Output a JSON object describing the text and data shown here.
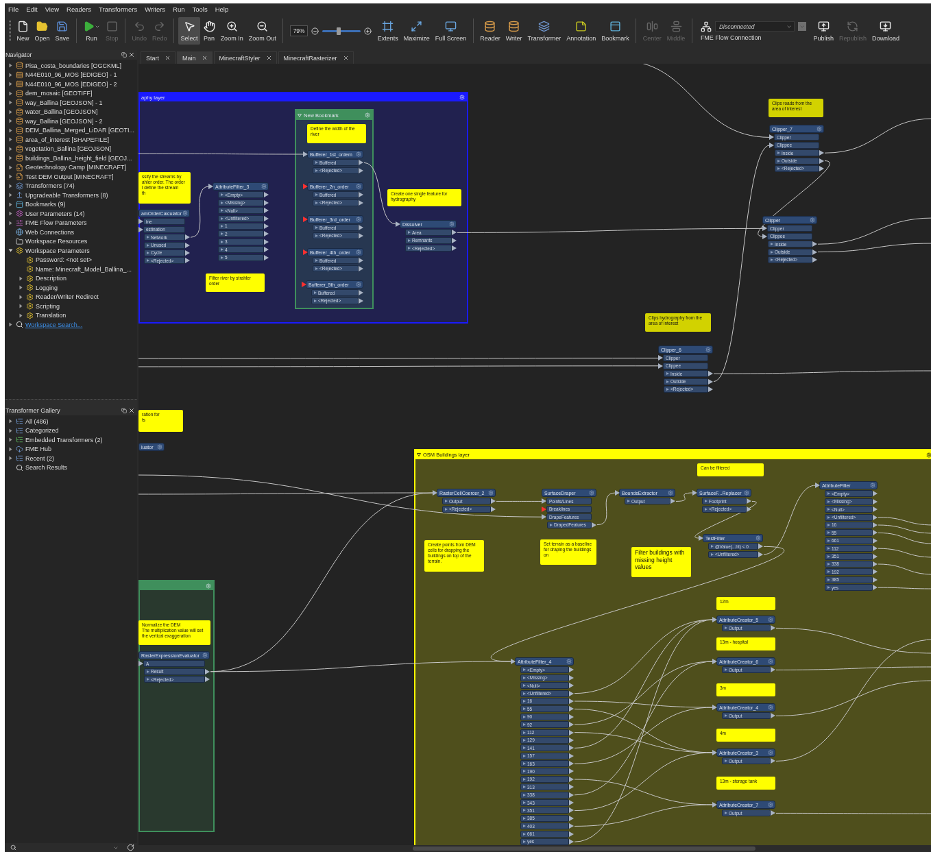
{
  "menu": [
    "File",
    "Edit",
    "View",
    "Readers",
    "Transformers",
    "Writers",
    "Run",
    "Tools",
    "Help"
  ],
  "toolbar": {
    "file": [
      {
        "kind": "new",
        "label": "New",
        "disabled": false
      },
      {
        "kind": "open",
        "label": "Open",
        "disabled": false
      },
      {
        "kind": "save",
        "label": "Save",
        "disabled": false
      }
    ],
    "run": [
      {
        "kind": "run",
        "label": "Run",
        "disabled": false
      },
      {
        "kind": "stop",
        "label": "Stop",
        "disabled": true
      }
    ],
    "edit": [
      {
        "kind": "undo",
        "label": "Undo",
        "disabled": true
      },
      {
        "kind": "redo",
        "label": "Redo",
        "disabled": true
      }
    ],
    "tools": [
      {
        "kind": "select",
        "label": "Select",
        "disabled": false,
        "selected": true
      },
      {
        "kind": "pan",
        "label": "Pan",
        "disabled": false,
        "selected": false
      },
      {
        "kind": "zoom-in",
        "label": "Zoom In",
        "disabled": false,
        "selected": false
      },
      {
        "kind": "zoom-out",
        "label": "Zoom Out",
        "disabled": false,
        "selected": false
      }
    ],
    "zoom": {
      "value": "79%",
      "level": 0.42
    },
    "view": [
      {
        "kind": "extents",
        "label": "Extents",
        "disabled": false
      },
      {
        "kind": "maximize",
        "label": "Maximize",
        "disabled": false
      },
      {
        "kind": "full-screen",
        "label": "Full Screen",
        "disabled": false
      }
    ],
    "add": [
      {
        "kind": "reader",
        "label": "Reader",
        "disabled": false
      },
      {
        "kind": "writer",
        "label": "Writer",
        "disabled": false
      },
      {
        "kind": "transformer",
        "label": "Transformer",
        "disabled": false
      },
      {
        "kind": "annotation",
        "label": "Annotation",
        "disabled": false
      },
      {
        "kind": "bookmark",
        "label": "Bookmark",
        "disabled": false
      }
    ],
    "align": [
      {
        "kind": "center",
        "label": "Center",
        "disabled": true
      },
      {
        "kind": "middle",
        "label": "Middle",
        "disabled": true
      }
    ],
    "flow": {
      "status": "Disconnected",
      "label": "FME Flow Connection"
    },
    "publish": [
      {
        "kind": "publish",
        "label": "Publish",
        "disabled": false
      },
      {
        "kind": "republish",
        "label": "Republish",
        "disabled": true
      },
      {
        "kind": "download",
        "label": "Download",
        "disabled": false
      }
    ]
  },
  "navigator": {
    "title": "Navigator",
    "items": [
      {
        "label": "Pisa_costa_boundaries [OGCKML]",
        "kind": "reader",
        "collapsible": true,
        "expanded": false
      },
      {
        "label": "N44E010_96_MOS [EDIGEO] - 1",
        "kind": "raster",
        "collapsible": true,
        "expanded": false
      },
      {
        "label": "N44E010_96_MOS [EDIGEO] - 2",
        "kind": "raster",
        "collapsible": true,
        "expanded": false
      },
      {
        "label": "dem_mosaic [GEOTIFF]",
        "kind": "reader",
        "collapsible": true,
        "expanded": false
      },
      {
        "label": "way_Ballina [GEOJSON] - 1",
        "kind": "reader",
        "collapsible": true,
        "expanded": false
      },
      {
        "label": "water_Ballina [GEOJSON]",
        "kind": "reader",
        "collapsible": true,
        "expanded": false
      },
      {
        "label": "way_Ballina [GEOJSON] - 2",
        "kind": "reader",
        "collapsible": true,
        "expanded": false
      },
      {
        "label": "DEM_Ballina_Merged_LiDAR [GEOTI...",
        "kind": "reader",
        "collapsible": true,
        "expanded": false
      },
      {
        "label": "area_of_interest [SHAPEFILE]",
        "kind": "reader",
        "collapsible": true,
        "expanded": false
      },
      {
        "label": "vegetation_Ballina [GEOJSON]",
        "kind": "reader",
        "collapsible": true,
        "expanded": false
      },
      {
        "label": "buildings_Ballina_height_field [GEOJ...",
        "kind": "reader",
        "collapsible": true,
        "expanded": false
      },
      {
        "label": "Geotechnology Camp [MINECRAFT]",
        "kind": "writer",
        "collapsible": true,
        "expanded": false
      },
      {
        "label": "Test DEM Output [MINECRAFT]",
        "kind": "writer",
        "collapsible": true,
        "expanded": false
      },
      {
        "label": "Transformers (74)",
        "kind": "transformers",
        "collapsible": true,
        "expanded": false
      },
      {
        "label": "Upgradeable Transformers (8)",
        "kind": "upgradeable",
        "collapsible": true,
        "expanded": false
      },
      {
        "label": "Bookmarks (9)",
        "kind": "bookmarks",
        "collapsible": true,
        "expanded": false
      },
      {
        "label": "User Parameters (14)",
        "kind": "user-params",
        "collapsible": true,
        "expanded": false
      },
      {
        "label": "FME Flow Parameters",
        "kind": "flow-params",
        "collapsible": true,
        "expanded": false
      },
      {
        "label": "Web Connections",
        "kind": "web",
        "collapsible": false
      },
      {
        "label": "Workspace Resources",
        "kind": "resources",
        "collapsible": false
      },
      {
        "label": "Workspace Parameters",
        "kind": "params",
        "collapsible": true,
        "expanded": true,
        "children": [
          {
            "label": "Password: <not set>",
            "kind": "params",
            "collapsible": false
          },
          {
            "label": "Name: Minecraft_Model_Ballina_...",
            "kind": "params",
            "collapsible": false
          },
          {
            "label": "Description",
            "kind": "params",
            "collapsible": true,
            "expanded": false
          },
          {
            "label": "Logging",
            "kind": "params",
            "collapsible": true,
            "expanded": false
          },
          {
            "label": "Reader/Writer Redirect",
            "kind": "params",
            "collapsible": true,
            "expanded": false
          },
          {
            "label": "Scripting",
            "kind": "params",
            "collapsible": true,
            "expanded": false
          },
          {
            "label": "Translation",
            "kind": "params",
            "collapsible": true,
            "expanded": false
          }
        ]
      },
      {
        "label": "Workspace Search...",
        "kind": "link",
        "collapsible": true,
        "expanded": false
      }
    ]
  },
  "gallery": {
    "title": "Transformer Gallery",
    "items": [
      {
        "label": "All (486)",
        "kind": "list",
        "collapsible": true,
        "expanded": false
      },
      {
        "label": "Categorized",
        "kind": "list",
        "collapsible": true,
        "expanded": false
      },
      {
        "label": "Embedded Transformers (2)",
        "kind": "embedded",
        "collapsible": true,
        "expanded": false
      },
      {
        "label": "FME Hub",
        "kind": "hub",
        "collapsible": true,
        "expanded": false
      },
      {
        "label": "Recent (2)",
        "kind": "list",
        "collapsible": true,
        "expanded": false
      },
      {
        "label": "Search Results",
        "kind": "search",
        "collapsible": false
      }
    ]
  },
  "tabs": [
    {
      "label": "Start",
      "selected": false
    },
    {
      "label": "Main",
      "selected": true
    },
    {
      "label": "MinecraftStyler",
      "selected": false
    },
    {
      "label": "MinecraftRasterizer",
      "selected": false
    }
  ],
  "canvas": {
    "bookmarks": [
      {
        "title": "aphy layer",
        "color": "#1a1aff",
        "collapse_arrow": false
      },
      {
        "title": "New Bookmark",
        "color": "#3f8f5c",
        "collapse_arrow": true
      },
      {
        "title": "OSM Buildings layer",
        "color": "#ffff00",
        "collapse_arrow": true
      },
      {
        "color": "#3f8f5c",
        "collapse_arrow": false
      }
    ],
    "annotations": [
      {
        "text": "Define the width of the river",
        "color": "#ffff00"
      },
      {
        "text": "ssify the streams by\nahler order. The order\nl define the stream\nth",
        "color": "#ffff00"
      },
      {
        "text": "Filter river by strahler order",
        "color": "#ffff00"
      },
      {
        "text": "Create one single feature for hydrography",
        "color": "#ffff00"
      },
      {
        "text": "Clips roads from the area of interest",
        "color": "#d2d200"
      },
      {
        "text": "Clips hydrography from the area of interest",
        "color": "#d2d200"
      },
      {
        "text": "ration for\nts",
        "color": "#ffff00"
      },
      {
        "text": "Can be filtered",
        "color": "#ffff00"
      },
      {
        "text": "Create points from DEM cells for drapping the buildings on top of the terrain.",
        "color": "#ffff00"
      },
      {
        "text": "Set terrain as a baseline for draping the buildings on",
        "color": "#ffff00"
      },
      {
        "text": "Filter buildings with missing height values",
        "color": "#ffff00"
      },
      {
        "text": "Normalize the DEM\nThe multiplication value will set the vertical exaggeration",
        "color": "#ffff00"
      },
      {
        "text": "12m",
        "color": "#ffff00"
      },
      {
        "text": "13m - hospital",
        "color": "#ffff00"
      },
      {
        "text": "3m",
        "color": "#ffff00"
      },
      {
        "text": "4m",
        "color": "#ffff00"
      },
      {
        "text": "13m - storage tank",
        "color": "#ffff00"
      }
    ],
    "transformers": [
      {
        "name": "amOrderCalculator",
        "inputs": [
          {
            "name": "ine",
            "warning": false
          },
          {
            "name": "estination",
            "warning": false
          }
        ],
        "outputs": [
          "Network",
          "Unused",
          "Cycle",
          "<Rejected>"
        ]
      },
      {
        "name": "AttributeFilter_3",
        "input_warning": false,
        "outputs": [
          "<Empty>",
          "<Missing>",
          "<Null>",
          "<Unfiltered>",
          "1",
          "2",
          "3",
          "4",
          "5"
        ]
      },
      {
        "name": "Bufferer_1st_ordem",
        "input_warning": false,
        "outputs": [
          "Buffered",
          "<Rejected>"
        ]
      },
      {
        "name": "Bufferer_2n_order",
        "input_warning": true,
        "outputs": [
          "Buffered",
          "<Rejected>"
        ]
      },
      {
        "name": "Bufferer_3rd_order",
        "input_warning": true,
        "outputs": [
          "Buffered",
          "<Rejected>"
        ]
      },
      {
        "name": "Bufferer_4th_order",
        "input_warning": true,
        "outputs": [
          "Buffered",
          "<Rejected>"
        ]
      },
      {
        "name": "Bufferer_5th_order",
        "input_warning": true,
        "outputs": [
          "Buffered",
          "<Rejected>"
        ]
      },
      {
        "name": "Dissolver",
        "input_warning": false,
        "outputs": [
          "Area",
          "Remnants",
          "<Rejected>"
        ]
      },
      {
        "name": "Clipper_7",
        "inputs": [
          {
            "name": "Clipper",
            "warning": false
          },
          {
            "name": "Clippee",
            "warning": false
          }
        ],
        "outputs": [
          "Inside",
          "Outside",
          "<Rejected>"
        ]
      },
      {
        "name": "Clipper",
        "inputs": [
          {
            "name": "Clipper",
            "warning": false
          },
          {
            "name": "Clippee",
            "warning": false
          }
        ],
        "outputs": [
          "Inside",
          "Outside",
          "<Rejected>"
        ]
      },
      {
        "name": "Clipper_6",
        "inputs": [
          {
            "name": "Clipper",
            "warning": false
          },
          {
            "name": "Clippee",
            "warning": false
          }
        ],
        "outputs": [
          "Inside",
          "Outside",
          "<Rejected>"
        ]
      },
      {
        "name": "luator"
      },
      {
        "name": "RasterExpressionEvaluator",
        "inputs": [
          {
            "name": "A",
            "warning": false
          }
        ],
        "outputs": [
          "Result",
          "<Rejected>"
        ]
      },
      {
        "name": "RasterCellCoercer_2",
        "input_warning": false,
        "outputs": [
          "Output",
          "<Rejected>"
        ]
      },
      {
        "name": "SurfaceDraper",
        "inputs": [
          {
            "name": "Points/Lines",
            "warning": false
          },
          {
            "name": "Breaklines",
            "warning": true
          },
          {
            "name": "DrapeFeatures",
            "warning": false
          }
        ],
        "outputs": [
          "DrapedFeatures"
        ]
      },
      {
        "name": "BoundsExtractor",
        "input_warning": false,
        "outputs": [
          "Output"
        ]
      },
      {
        "name": "SurfaceF...Replacer",
        "input_warning": false,
        "outputs": [
          "Footprint",
          "<Rejected>"
        ]
      },
      {
        "name": "AttributeFilter",
        "input_warning": false,
        "outputs": [
          "<Empty>",
          "<Missing>",
          "<Null>",
          "<Unfiltered>",
          "16",
          "55",
          "661",
          "112",
          "351",
          "338",
          "192",
          "385",
          "yes"
        ]
      },
      {
        "name": "TestFilter",
        "input_warning": false,
        "outputs": [
          "@Value(...ht) < 0",
          "<Unfiltered>"
        ]
      },
      {
        "name": "AttributeCreator_5",
        "input_warning": false,
        "outputs": [
          "Output"
        ]
      },
      {
        "name": "AttributeCreator_6",
        "input_warning": false,
        "outputs": [
          "Output"
        ]
      },
      {
        "name": "AttributeCreator_4",
        "input_warning": false,
        "outputs": [
          "Output"
        ]
      },
      {
        "name": "AttributeCreator_3",
        "input_warning": false,
        "outputs": [
          "Output"
        ]
      },
      {
        "name": "AttributeCreator_7",
        "input_warning": false,
        "outputs": [
          "Output"
        ]
      },
      {
        "name": "AttributeFilter_4",
        "input_warning": false,
        "outputs": [
          "<Empty>",
          "<Missing>",
          "<Null>",
          "<Unfiltered>",
          "16",
          "55",
          "90",
          "92",
          "112",
          "129",
          "141",
          "157",
          "163",
          "190",
          "192",
          "313",
          "338",
          "343",
          "351",
          "385",
          "403",
          "661",
          "yes"
        ]
      }
    ]
  }
}
